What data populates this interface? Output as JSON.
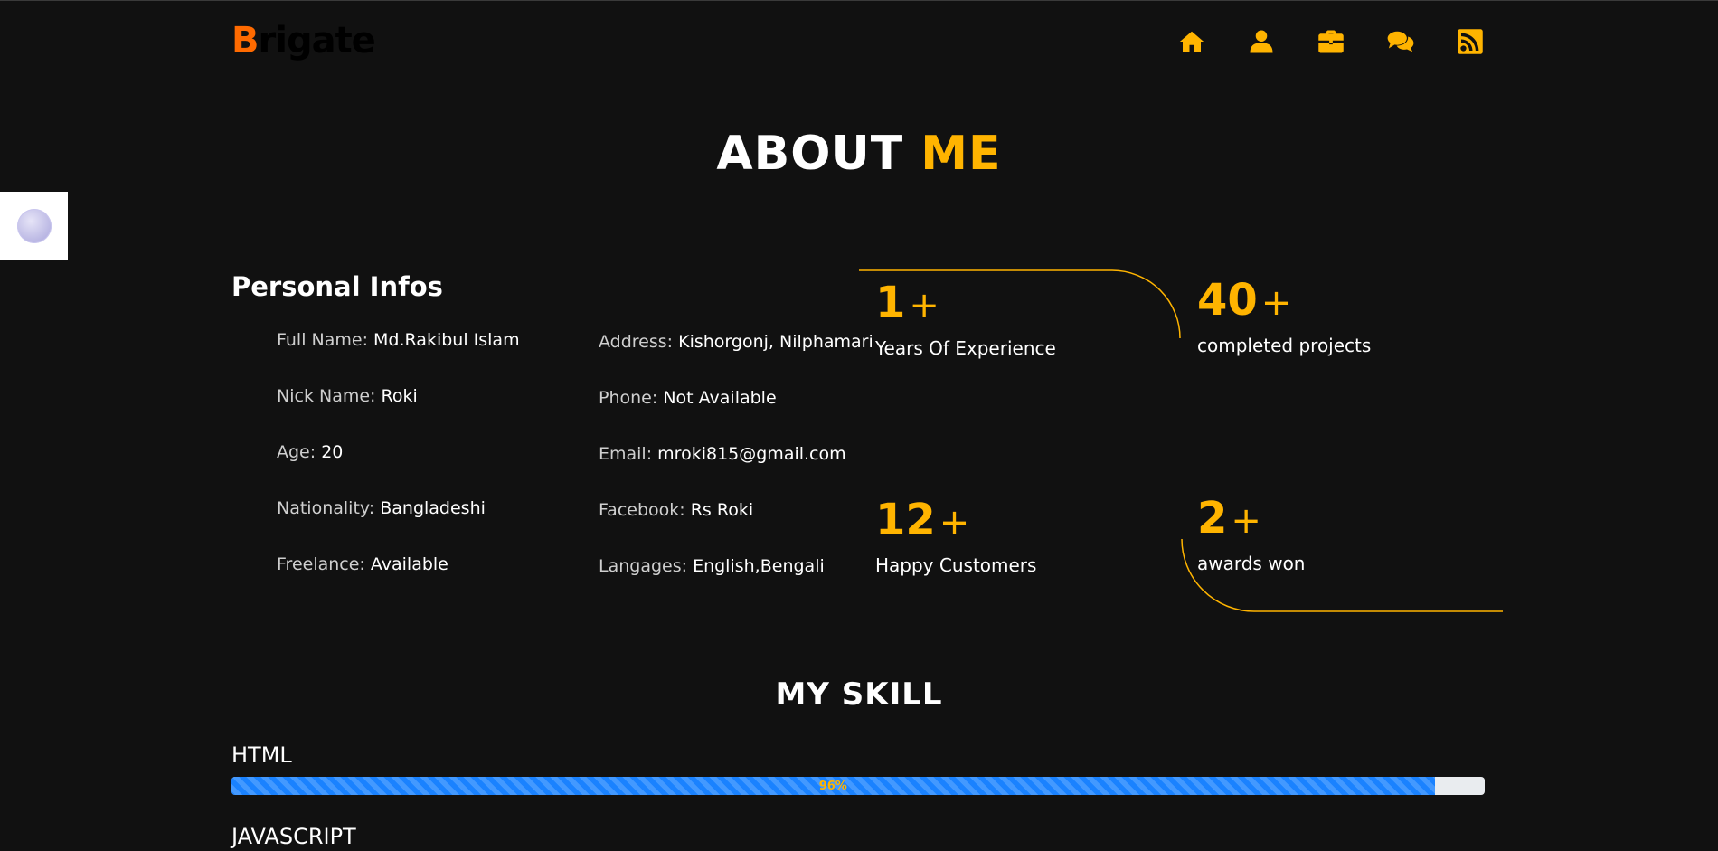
{
  "header": {
    "logo_first": "B",
    "logo_rest": "rigate",
    "nav": [
      {
        "icon": "home-icon"
      },
      {
        "icon": "user-icon"
      },
      {
        "icon": "briefcase-icon"
      },
      {
        "icon": "comments-icon"
      },
      {
        "icon": "rss-icon"
      }
    ]
  },
  "about": {
    "title_main": "ABOUT",
    "title_accent": "ME",
    "section_title": "Personal Infos",
    "info_left": [
      {
        "key": "Full Name:",
        "value": "Md.Rakibul Islam"
      },
      {
        "key": "Nick Name:",
        "value": "Roki"
      },
      {
        "key": "Age:",
        "value": "20"
      },
      {
        "key": "Nationality:",
        "value": "Bangladeshi"
      },
      {
        "key": "Freelance:",
        "value": "Available"
      }
    ],
    "info_right": [
      {
        "key": "Address:",
        "value": "Kishorgonj, Nilphamari"
      },
      {
        "key": "Phone:",
        "value": "Not Available"
      },
      {
        "key": "Email:",
        "value": "mroki815@gmail.com"
      },
      {
        "key": "Facebook:",
        "value": "Rs Roki"
      },
      {
        "key": "Langages:",
        "value": "English,Bengali"
      }
    ]
  },
  "stats": [
    {
      "number": "1",
      "suffix": "+",
      "label": "Years Of Experience"
    },
    {
      "number": "40",
      "suffix": "+",
      "label": "completed projects"
    },
    {
      "number": "12",
      "suffix": "+",
      "label": "Happy Customers"
    },
    {
      "number": "2",
      "suffix": "+",
      "label": "awards won"
    }
  ],
  "skills": {
    "title": "MY SKILL",
    "items": [
      {
        "name": "HTML",
        "percent": 96,
        "percent_label": "96%"
      },
      {
        "name": "JAVASCRIPT"
      }
    ]
  },
  "colors": {
    "accent": "#ffb400",
    "logo_accent": "#ff6a00",
    "background": "#111111",
    "progress": "#1a82ff"
  }
}
